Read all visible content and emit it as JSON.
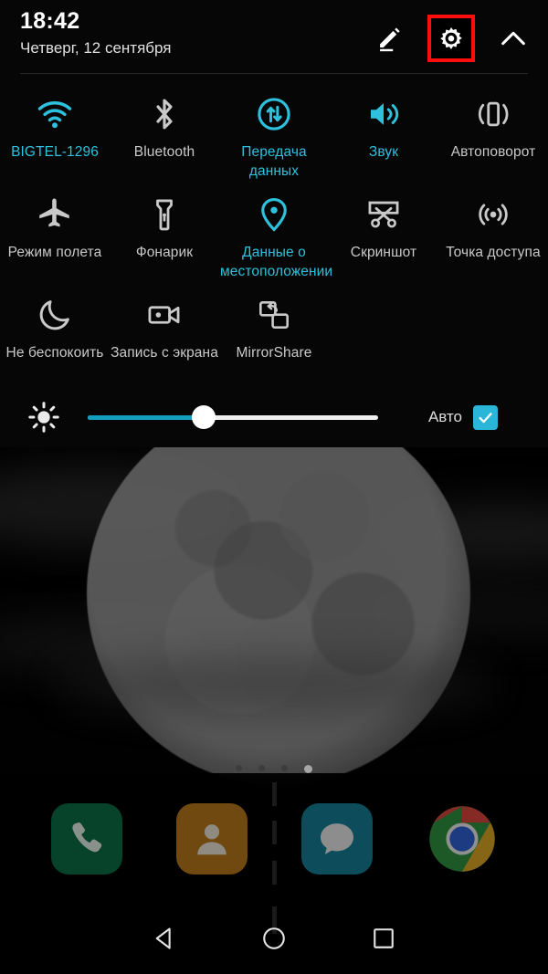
{
  "statusbar": {
    "time": "18:42",
    "date": "Четверг, 12 сентября"
  },
  "header": {
    "edit_icon": "pencil-icon",
    "settings_icon": "gear-icon",
    "collapse_icon": "chevron-up-icon",
    "highlight_color": "#ff0d0d"
  },
  "colors": {
    "accent_on": "#2ec1dd",
    "label_off": "#c9c9c9",
    "slider_fill": "#139dbf",
    "checkbox": "#29b6d8",
    "panel_bg": "#060606"
  },
  "tiles": [
    {
      "label": "BIGTEL-1296",
      "icon": "wifi-icon",
      "active": true
    },
    {
      "label": "Bluetooth",
      "icon": "bluetooth-icon",
      "active": false
    },
    {
      "label": "Передача данных",
      "icon": "data-transfer-icon",
      "active": true
    },
    {
      "label": "Звук",
      "icon": "volume-icon",
      "active": true
    },
    {
      "label": "Автоповорот",
      "icon": "auto-rotate-icon",
      "active": false
    },
    {
      "label": "Режим полета",
      "icon": "airplane-icon",
      "active": false
    },
    {
      "label": "Фонарик",
      "icon": "flashlight-icon",
      "active": false
    },
    {
      "label": "Данные о местоположении",
      "icon": "location-pin-icon",
      "active": true
    },
    {
      "label": "Скриншот",
      "icon": "screenshot-icon",
      "active": false
    },
    {
      "label": "Точка доступа",
      "icon": "hotspot-icon",
      "active": false
    },
    {
      "label": "Не беспокоить",
      "icon": "moon-icon",
      "active": false
    },
    {
      "label": "Запись с экрана",
      "icon": "screen-record-icon",
      "active": false
    },
    {
      "label": "MirrorShare",
      "icon": "mirror-share-icon",
      "active": false
    }
  ],
  "brightness": {
    "icon": "brightness-icon",
    "value_percent": 40,
    "auto_label": "Авто",
    "auto_checked": true
  },
  "home": {
    "page_dots": {
      "count": 4,
      "active_index": 3
    },
    "dock": [
      {
        "label": "Телефон",
        "icon": "phone-icon",
        "color": "#0b6b44"
      },
      {
        "label": "Контакты",
        "icon": "contacts-icon",
        "color": "#b5751a"
      },
      {
        "label": "Сообщения",
        "icon": "message-icon",
        "color": "#137b93"
      },
      {
        "label": "Chrome",
        "icon": "chrome-icon",
        "color": "#d8443c"
      }
    ]
  },
  "navbar": [
    {
      "label": "Назад",
      "icon": "back-triangle-icon"
    },
    {
      "label": "Главный",
      "icon": "home-circle-icon"
    },
    {
      "label": "Обзор",
      "icon": "recents-square-icon"
    }
  ]
}
